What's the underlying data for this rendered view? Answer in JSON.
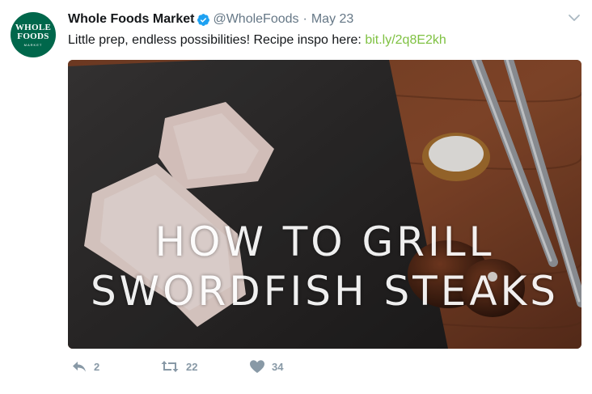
{
  "tweet": {
    "avatar": {
      "line1": "WHOLE",
      "line2": "FOODS",
      "line3": "MARKET",
      "bg_color": "#00674b"
    },
    "display_name": "Whole Foods Market",
    "verified_icon": "verified-badge-icon",
    "handle": "@WholeFoods",
    "separator": "·",
    "date": "May 23",
    "text": "Little prep, endless possibilities! Recipe inspo here: ",
    "link_text": "bit.ly/2q8E2kh",
    "link_color": "#7fc142",
    "media": {
      "overlay_line1": "HOW TO GRILL",
      "overlay_line2": "SWORDFISH STEAKS"
    },
    "actions": {
      "reply_count": "2",
      "retweet_count": "22",
      "like_count": "34"
    }
  }
}
